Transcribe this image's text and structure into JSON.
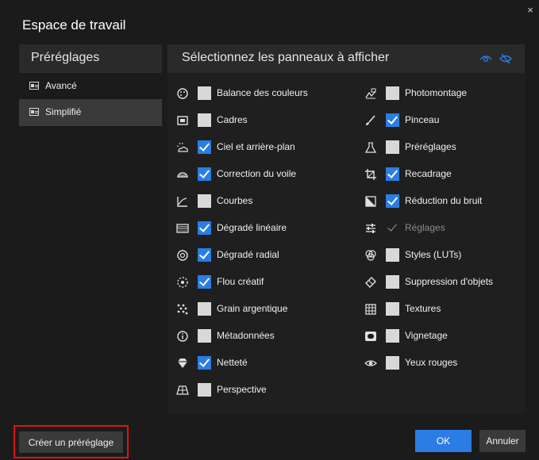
{
  "dialog": {
    "title": "Espace de travail",
    "close_glyph": "×"
  },
  "presets": {
    "header": "Préréglages",
    "items": [
      {
        "label": "Avancé",
        "icon": "preset-card-icon",
        "selected": false
      },
      {
        "label": "Simplifié",
        "icon": "preset-card-icon",
        "selected": true
      }
    ]
  },
  "panels": {
    "header": "Sélectionnez les panneaux à afficher",
    "show_all_icon": "eye-icon",
    "hide_all_icon": "eye-off-icon",
    "accent": "#2b7de4",
    "left_column": [
      {
        "label": "Balance des couleurs",
        "checked": false,
        "icon": "color-palette-icon"
      },
      {
        "label": "Cadres",
        "checked": false,
        "icon": "frame-icon"
      },
      {
        "label": "Ciel et arrière-plan",
        "checked": true,
        "icon": "sun-cloud-icon"
      },
      {
        "label": "Correction du voile",
        "checked": true,
        "icon": "haze-icon"
      },
      {
        "label": "Courbes",
        "checked": false,
        "icon": "curves-icon"
      },
      {
        "label": "Dégradé linéaire",
        "checked": true,
        "icon": "linear-gradient-icon"
      },
      {
        "label": "Dégradé radial",
        "checked": true,
        "icon": "radial-gradient-icon"
      },
      {
        "label": "Flou créatif",
        "checked": true,
        "icon": "creative-blur-icon"
      },
      {
        "label": "Grain argentique",
        "checked": false,
        "icon": "film-grain-icon"
      },
      {
        "label": "Métadonnées",
        "checked": false,
        "icon": "info-icon"
      },
      {
        "label": "Netteté",
        "checked": true,
        "icon": "diamond-sharpen-icon"
      },
      {
        "label": "Perspective",
        "checked": false,
        "icon": "perspective-grid-icon"
      }
    ],
    "right_column": [
      {
        "label": "Photomontage",
        "checked": false,
        "icon": "photomontage-icon"
      },
      {
        "label": "Pinceau",
        "checked": true,
        "icon": "brush-icon"
      },
      {
        "label": "Préréglages",
        "checked": false,
        "icon": "flask-icon"
      },
      {
        "label": "Recadrage",
        "checked": true,
        "icon": "crop-icon"
      },
      {
        "label": "Réduction du bruit",
        "checked": true,
        "icon": "noise-reduction-icon"
      },
      {
        "label": "Réglages",
        "checked": true,
        "disabled": true,
        "icon": "sliders-icon"
      },
      {
        "label": "Styles (LUTs)",
        "checked": false,
        "icon": "luts-icon"
      },
      {
        "label": "Suppression d'objets",
        "checked": false,
        "icon": "eraser-icon"
      },
      {
        "label": "Textures",
        "checked": false,
        "icon": "texture-icon"
      },
      {
        "label": "Vignetage",
        "checked": false,
        "icon": "vignette-icon"
      },
      {
        "label": "Yeux rouges",
        "checked": false,
        "icon": "red-eye-icon"
      }
    ]
  },
  "footer": {
    "create_preset_label": "Créer un préréglage",
    "ok_label": "OK",
    "cancel_label": "Annuler",
    "highlight_color": "#e01218"
  }
}
